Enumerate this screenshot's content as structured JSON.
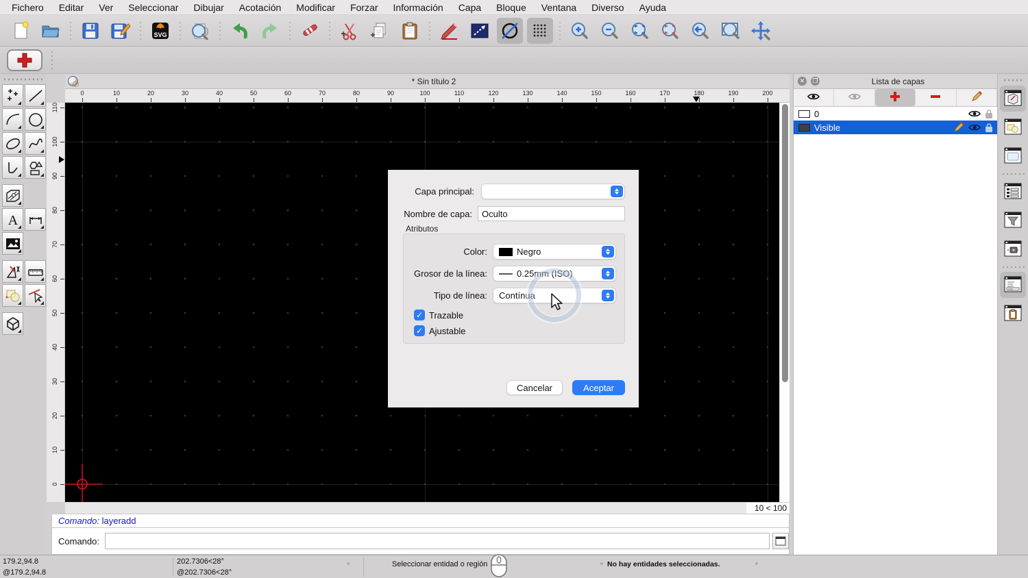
{
  "menubar": {
    "items": [
      "Fichero",
      "Editar",
      "Ver",
      "Seleccionar",
      "Dibujar",
      "Acotación",
      "Modificar",
      "Forzar",
      "Información",
      "Capa",
      "Bloque",
      "Ventana",
      "Diverso",
      "Ayuda"
    ]
  },
  "toolbar": {
    "svg_badge": "SVG",
    "items": [
      "new-file",
      "open-file",
      "sep",
      "save",
      "save-as",
      "sep",
      "svg-export",
      "sep",
      "print-preview",
      "sep",
      "undo",
      "redo",
      "sep",
      "delete-eraser",
      "sep",
      "cut",
      "copy",
      "paste",
      "sep",
      "draw-pen",
      "line-ortho",
      "snap-circle:pressed",
      "grid-toggle:pressed",
      "sep",
      "zoom-in",
      "zoom-out",
      "zoom-auto",
      "zoom-previous",
      "zoom-redraw",
      "zoom-window",
      "zoom-pan"
    ]
  },
  "pen_toolbar": {
    "button": "pen-add"
  },
  "left_tools": {
    "rows": [
      [
        "point",
        "line"
      ],
      [
        "arc",
        "circle"
      ],
      [
        "ellipse",
        "spline"
      ],
      [
        "polyline",
        "polygon"
      ],
      [
        "hatch",
        null
      ],
      [
        "text",
        "dimension"
      ],
      [
        "image",
        null
      ],
      [
        "draft",
        "measure"
      ],
      [
        "shapes",
        "select-entity"
      ],
      [
        "cube",
        null
      ]
    ]
  },
  "document": {
    "title": "* Sin título 2",
    "h_ruler": [
      0,
      10,
      20,
      30,
      40,
      50,
      60,
      70,
      80,
      90,
      100,
      110,
      120,
      130,
      140,
      150,
      160,
      170,
      180,
      190,
      200
    ],
    "v_ruler": [
      110,
      100,
      90,
      80,
      70,
      60,
      50,
      40,
      30,
      20,
      10,
      0
    ],
    "h_marker_value": 179.2,
    "v_marker_value": 94.8,
    "grid_status": "10 < 100"
  },
  "dialog": {
    "parent_label": "Capa principal:",
    "parent_value": "",
    "name_label": "Nombre de capa:",
    "name_value": "Oculto",
    "attributes_label": "Atributos",
    "color_label": "Color:",
    "color_value": "Negro",
    "width_label": "Grosor de la línea:",
    "width_value": "0.25mm (ISO)",
    "linetype_label": "Tipo de línea:",
    "linetype_value": "Contínua",
    "construction_label": "Trazable",
    "construction_checked": true,
    "adjustable_label": "Ajustable",
    "adjustable_checked": true,
    "cancel_label": "Cancelar",
    "ok_label": "Aceptar",
    "accent_color": "#2f7bf5"
  },
  "layer_panel": {
    "title": "Lista de capas",
    "toolbar": [
      "show-all-eye",
      "hide-all-eye",
      "add-layer:pressed",
      "remove-layer",
      "edit-layer"
    ],
    "layers": [
      {
        "name": "0",
        "swatch_color": "#ffffff",
        "selected": false,
        "icons": [
          "eye",
          "lock"
        ]
      },
      {
        "name": "Visible",
        "swatch_color": "#3a4148",
        "selected": true,
        "icons": [
          "pencil",
          "eye",
          "lock"
        ]
      }
    ],
    "selection_color": "#1560d6"
  },
  "right_strip": {
    "panels": [
      "layer-list-panel:active",
      "block-list-panel",
      "library-browser-panel",
      "sep",
      "entity-list-panel",
      "selection-filter-panel",
      "notes-panel",
      "sep",
      "command-panel:active",
      "clipboard-panel"
    ]
  },
  "command": {
    "history_label": "Comando:",
    "history_value": "layeradd",
    "input_label": "Comando:",
    "input_value": ""
  },
  "statusbar": {
    "abs_coord": "179.2,94.8",
    "rel_coord": "@179.2,94.8",
    "abs_polar": "202.7306<28°",
    "rel_polar": "@202.7306<28°",
    "hint": "Seleccionar entidad o región",
    "selection_msg": "No hay entidades seleccionadas."
  }
}
